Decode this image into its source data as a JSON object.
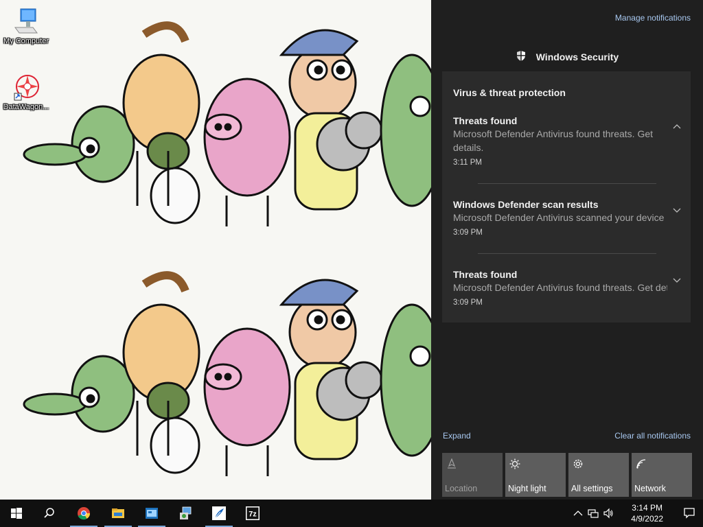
{
  "desktop": {
    "icons": [
      {
        "label": "My Computer"
      },
      {
        "label": "DataWagon..."
      }
    ]
  },
  "action_center": {
    "manage_notifications": "Manage notifications",
    "app_name": "Windows Security",
    "card_title": "Virus & threat protection",
    "notifications": [
      {
        "title": "Threats found",
        "body": "Microsoft Defender Antivirus found threats. Get details.",
        "time": "3:11 PM",
        "expanded": true
      },
      {
        "title": "Windows Defender scan results",
        "body": "Microsoft Defender Antivirus scanned your device",
        "time": "3:09 PM",
        "expanded": false
      },
      {
        "title": "Threats found",
        "body": "Microsoft Defender Antivirus found threats. Get details.",
        "time": "3:09 PM",
        "expanded": false
      }
    ],
    "expand_label": "Expand",
    "clear_all_label": "Clear all notifications",
    "quick_actions": [
      {
        "label": "Location",
        "icon": "location-icon",
        "enabled": false
      },
      {
        "label": "Night light",
        "icon": "night-light-icon",
        "enabled": true
      },
      {
        "label": "All settings",
        "icon": "gear-icon",
        "enabled": true
      },
      {
        "label": "Network",
        "icon": "network-icon",
        "enabled": true
      }
    ]
  },
  "taskbar": {
    "pinned": [
      "start-icon",
      "search-icon",
      "chrome-icon",
      "file-explorer-icon",
      "app-icon",
      "installer-icon",
      "feather-app-icon",
      "7zip-icon"
    ],
    "clock_time": "3:14 PM",
    "clock_date": "4/9/2022"
  },
  "colors": {
    "panel_bg": "#1f1f1f",
    "card_bg": "#2b2b2b",
    "link": "#a8c8f0",
    "taskbar_bg": "#101010",
    "accent": "#7aa7d8"
  }
}
